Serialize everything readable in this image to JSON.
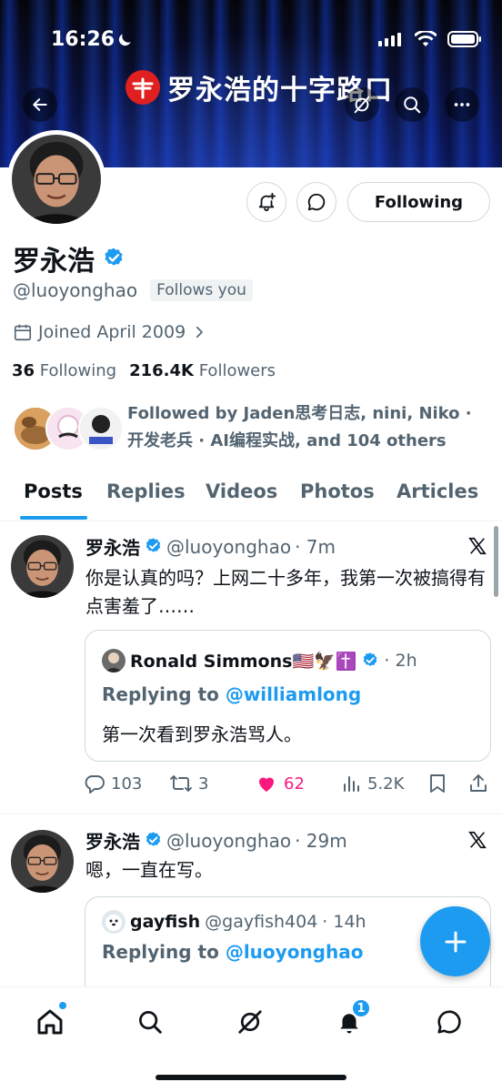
{
  "status_bar": {
    "time": "16:26"
  },
  "banner": {
    "title": "罗永浩的十字路口"
  },
  "profile": {
    "display_name": "罗永浩",
    "handle": "@luoyonghao",
    "follows_you": "Follows you",
    "joined": "Joined April 2009",
    "following_count": "36",
    "following_label": "Following",
    "followers_count": "216.4K",
    "followers_label": "Followers",
    "followed_by": "Followed by Jaden思考日志, nini, Niko · 开发老兵 · AI编程实战, and 104 others",
    "following_button": "Following"
  },
  "tabs": [
    {
      "label": "Posts",
      "active": true
    },
    {
      "label": "Replies"
    },
    {
      "label": "Videos"
    },
    {
      "label": "Photos"
    },
    {
      "label": "Articles"
    }
  ],
  "posts": [
    {
      "name": "罗永浩",
      "handle": "@luoyonghao",
      "time": "· 7m",
      "text": "你是认真的吗？上网二十多年，我第一次被搞得有点害羞了……",
      "quote": {
        "name": "Ronald Simmons🇺🇸🦅✝️",
        "time": "· 2h",
        "replying_label": "Replying to",
        "replying_to": "@williamlong",
        "text": "第一次看到罗永浩骂人。"
      },
      "actions": {
        "replies": "103",
        "reposts": "3",
        "likes": "62",
        "views": "5.2K"
      }
    },
    {
      "name": "罗永浩",
      "handle": "@luoyonghao",
      "time": "· 29m",
      "text": "嗯，一直在写。",
      "quote": {
        "name": "gayfish",
        "handle": "@gayfish404",
        "time": "· 14h",
        "replying_label": "Replying to",
        "replying_to": "@luoyonghao"
      }
    }
  ],
  "bottom_nav": {
    "notifications_badge": "1"
  },
  "colors": {
    "accent": "#1d9bf0",
    "like": "#f91880",
    "secondary_text": "#536471"
  }
}
